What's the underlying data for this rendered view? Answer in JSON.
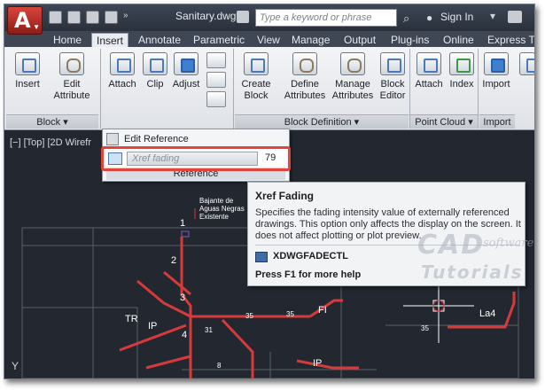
{
  "titlebar": {
    "doc_title": "Sanitary.dwg ...",
    "search_placeholder": "Type a keyword or phrase",
    "sign_in": "Sign In"
  },
  "tabs": [
    "Home",
    "Insert",
    "Annotate",
    "Parametric",
    "View",
    "Manage",
    "Output",
    "Plug-ins",
    "Online",
    "Express To"
  ],
  "active_tab": "Insert",
  "ribbon": {
    "block": {
      "insert": "Insert",
      "edit_attribute": [
        "Edit",
        "Attribute"
      ],
      "title": "Block"
    },
    "reference": {
      "attach": "Attach",
      "clip": "Clip",
      "adjust": "Adjust"
    },
    "block_definition": {
      "create_block": [
        "Create",
        "Block"
      ],
      "define_attributes": [
        "Define",
        "Attributes"
      ],
      "manage_attributes": [
        "Manage",
        "Attributes"
      ],
      "block_editor": [
        "Block",
        "Editor"
      ],
      "title": "Block Definition"
    },
    "point_cloud": {
      "attach": "Attach",
      "index": "Index",
      "title": "Point Cloud"
    },
    "import": {
      "import": "Import",
      "title": "Import"
    },
    "panel_dropdown_icon": "triangle-down-icon"
  },
  "viewport": {
    "label": "[−] [Top] [2D Wirefr"
  },
  "dropdown": {
    "edit_reference": "Edit Reference",
    "xref_fading_label": "Xref fading",
    "xref_fading_value": "79",
    "reference_title": "Reference"
  },
  "tooltip": {
    "title": "Xref Fading",
    "description": "Specifies the fading intensity value of externally referenced drawings. This option only affects the display on the screen. It does not affect plotting or plot preview.",
    "command": "XDWGFADECTL",
    "help": "Press F1 for more help"
  },
  "drawing_labels": {
    "note": [
      "Bajante de",
      "Aguas Negras",
      "Existente"
    ],
    "num1": "1",
    "num2": "2",
    "num3": "3",
    "num4": "4",
    "tr": "TR",
    "ip1": "IP",
    "ip2": "IP",
    "fi": "FI",
    "la4": "La4",
    "n35a": "35",
    "n35b": "35",
    "n35c": "35",
    "n31": "31",
    "n8": "8",
    "y_axis": "Y"
  },
  "watermark": {
    "line1": "CAD",
    "line2": "software",
    "line3": "Tutorials"
  },
  "colors": {
    "accent_red": "#e0443a",
    "drawing_red": "#d63a3a",
    "viewport_bg": "#232830"
  }
}
